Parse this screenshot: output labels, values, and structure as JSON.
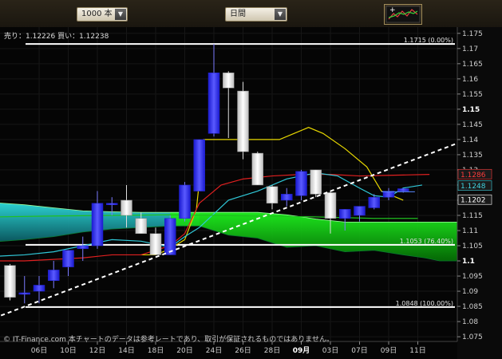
{
  "toolbar": {
    "bars_select": "1000 本",
    "period_select": "日間",
    "settings_icon": "chart-settings-icon"
  },
  "chart_info": {
    "price_line": "売り：1.12226 買い：1.12238"
  },
  "copyright": "© IT-Finance.com 本チャートのデータは参考レートであり、取引が保証されるものではありません。",
  "chart_data": {
    "type": "candlestick",
    "ylim": [
      1.075,
      1.175
    ],
    "y_ticks": [
      "1.175",
      "1.17",
      "1.165",
      "1.16",
      "1.155",
      "1.15",
      "1.145",
      "1.14",
      "1.135",
      "1.13",
      "1.125",
      "1.12",
      "1.115",
      "1.11",
      "1.105",
      "1.1",
      "1.095",
      "1.09",
      "1.085",
      "1.08",
      "1.075"
    ],
    "bold_y_ticks": [
      "1.15",
      "1.1"
    ],
    "x_labels": [
      "06日",
      "10日",
      "12日",
      "14日",
      "18日",
      "20日",
      "24日",
      "26日",
      "28日",
      "09月",
      "03日",
      "07日",
      "09日",
      "11日"
    ],
    "x_label_slots": [
      2,
      4,
      6,
      8,
      10,
      12,
      14,
      16,
      18,
      20,
      22,
      24,
      26,
      28
    ],
    "bold_x_labels": [
      "09月"
    ],
    "candles": [
      {
        "o": 1.0985,
        "h": 1.099,
        "l": 1.087,
        "c": 1.088
      },
      {
        "o": 1.089,
        "h": 1.095,
        "l": 1.086,
        "c": 1.0895
      },
      {
        "o": 1.09,
        "h": 1.095,
        "l": 1.086,
        "c": 1.092
      },
      {
        "o": 1.0935,
        "h": 1.1,
        "l": 1.091,
        "c": 1.097
      },
      {
        "o": 1.098,
        "h": 1.102,
        "l": 1.095,
        "c": 1.1035
      },
      {
        "o": 1.104,
        "h": 1.108,
        "l": 1.1,
        "c": 1.105
      },
      {
        "o": 1.105,
        "h": 1.123,
        "l": 1.104,
        "c": 1.119
      },
      {
        "o": 1.119,
        "h": 1.121,
        "l": 1.115,
        "c": 1.119
      },
      {
        "o": 1.12,
        "h": 1.125,
        "l": 1.111,
        "c": 1.115
      },
      {
        "o": 1.114,
        "h": 1.116,
        "l": 1.109,
        "c": 1.109
      },
      {
        "o": 1.109,
        "h": 1.111,
        "l": 1.102,
        "c": 1.102
      },
      {
        "o": 1.102,
        "h": 1.115,
        "l": 1.102,
        "c": 1.114
      },
      {
        "o": 1.114,
        "h": 1.126,
        "l": 1.113,
        "c": 1.125
      },
      {
        "o": 1.123,
        "h": 1.14,
        "l": 1.123,
        "c": 1.14
      },
      {
        "o": 1.142,
        "h": 1.1715,
        "l": 1.141,
        "c": 1.162
      },
      {
        "o": 1.162,
        "h": 1.1625,
        "l": 1.1405,
        "c": 1.157
      },
      {
        "o": 1.156,
        "h": 1.159,
        "l": 1.1335,
        "c": 1.136
      },
      {
        "o": 1.1355,
        "h": 1.136,
        "l": 1.125,
        "c": 1.125
      },
      {
        "o": 1.1245,
        "h": 1.125,
        "l": 1.117,
        "c": 1.119
      },
      {
        "o": 1.12,
        "h": 1.124,
        "l": 1.118,
        "c": 1.122
      },
      {
        "o": 1.1215,
        "h": 1.13,
        "l": 1.12,
        "c": 1.1295
      },
      {
        "o": 1.13,
        "h": 1.13,
        "l": 1.121,
        "c": 1.122
      },
      {
        "o": 1.1225,
        "h": 1.123,
        "l": 1.109,
        "c": 1.114
      },
      {
        "o": 1.114,
        "h": 1.117,
        "l": 1.11,
        "c": 1.117
      },
      {
        "o": 1.115,
        "h": 1.118,
        "l": 1.113,
        "c": 1.118
      },
      {
        "o": 1.1175,
        "h": 1.122,
        "l": 1.117,
        "c": 1.121
      },
      {
        "o": 1.121,
        "h": 1.124,
        "l": 1.12,
        "c": 1.123
      },
      {
        "o": 1.123,
        "h": 1.124,
        "l": 1.1225,
        "c": 1.1238
      }
    ],
    "fib_levels": [
      {
        "value": 1.1715,
        "label": "1.1715 (0.00%)"
      },
      {
        "value": 1.1053,
        "label": "1.1053 (76.40%)"
      },
      {
        "value": 1.0848,
        "label": "1.0848 (100.00%)"
      }
    ],
    "price_tags": [
      {
        "value": 1.1286,
        "text": "1.1286",
        "color": "#ff3b3b"
      },
      {
        "value": 1.1248,
        "text": "1.1248",
        "color": "#3fd3e0"
      },
      {
        "value": 1.1202,
        "text": "1.1202",
        "color": "#ffffff"
      }
    ],
    "trendline": {
      "from": [
        -2,
        1.0795
      ],
      "to": [
        32.5,
        1.142
      ]
    },
    "cloud": {
      "x": [
        -2,
        1,
        3,
        5,
        7,
        9,
        11,
        13,
        15,
        17,
        19,
        21,
        23,
        25,
        27,
        28.5,
        29.5,
        31.5,
        32.5
      ],
      "top": [
        1.1195,
        1.1185,
        1.1175,
        1.1165,
        1.1162,
        1.116,
        1.116,
        1.116,
        1.116,
        1.116,
        1.1152,
        1.1138,
        1.1128,
        1.1128,
        1.1128,
        1.1128,
        1.1128,
        1.1128,
        1.1128
      ],
      "bottom": [
        1.106,
        1.107,
        1.108,
        1.1095,
        1.1105,
        1.111,
        1.1115,
        1.1115,
        1.1085,
        1.1075,
        1.1045,
        1.105,
        1.103,
        1.1035,
        1.102,
        1.101,
        1.1,
        1.1,
        1.1
      ]
    },
    "indicators": [
      {
        "color": "#e8d800",
        "x": [
          9,
          10,
          11,
          12,
          12.8,
          13.3,
          14,
          15,
          18.5,
          19.5,
          20.5,
          21.5,
          23,
          24.5,
          25.5,
          27
        ],
        "y": [
          1.102,
          1.102,
          1.104,
          1.107,
          1.117,
          1.14,
          1.14,
          1.14,
          1.14,
          1.142,
          1.144,
          1.142,
          1.137,
          1.131,
          1.123,
          1.12
        ]
      },
      {
        "color": "#e02020",
        "x": [
          -1,
          1,
          3,
          5,
          7,
          9,
          11,
          12,
          13,
          14.5,
          16,
          18,
          20,
          22,
          24,
          26,
          27,
          28.8
        ],
        "y": [
          1.1,
          1.1,
          1.1005,
          1.101,
          1.102,
          1.102,
          1.105,
          1.109,
          1.119,
          1.125,
          1.127,
          1.128,
          1.1285,
          1.1285,
          1.128,
          1.1282,
          1.1283,
          1.1285
        ]
      },
      {
        "color": "#30c8d8",
        "x": [
          -1,
          1,
          3,
          5,
          7,
          9,
          11,
          12,
          13,
          15,
          17,
          19,
          21,
          22.5,
          24,
          25,
          26,
          27,
          28.3
        ],
        "y": [
          1.1015,
          1.102,
          1.103,
          1.105,
          1.107,
          1.1065,
          1.1045,
          1.108,
          1.111,
          1.12,
          1.123,
          1.127,
          1.129,
          1.128,
          1.124,
          1.1215,
          1.121,
          1.124,
          1.125
        ]
      },
      {
        "color": "#20c020",
        "x": [
          -1,
          3,
          7,
          11,
          14,
          17,
          21,
          25,
          28
        ],
        "y": [
          1.1145,
          1.1148,
          1.115,
          1.1152,
          1.115,
          1.1148,
          1.1145,
          1.114,
          1.114
        ]
      }
    ],
    "last_price_line": {
      "value": 1.1228
    }
  }
}
